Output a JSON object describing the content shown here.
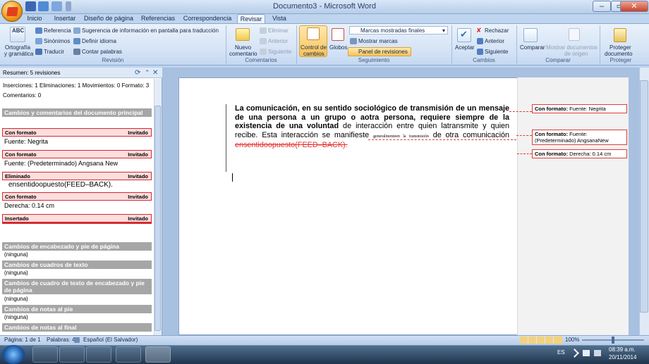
{
  "window": {
    "title": "Documento3 - Microsoft Word",
    "controls": {
      "minimize": "–",
      "maximize": "▭",
      "close": "✕"
    }
  },
  "tabs": [
    "Inicio",
    "Insertar",
    "Diseño de página",
    "Referencias",
    "Correspondencia",
    "Revisar",
    "Vista"
  ],
  "active_tab": "Revisar",
  "ribbon": {
    "revision": {
      "label": "Revisión",
      "ortografia": [
        "Ortografía",
        "y gramática"
      ],
      "referencia": "Referencia",
      "sinonimos": "Sinónimos",
      "traducir": "Traducir",
      "sugerencia": "Sugerencia de información en pantalla para traducción",
      "definir_idioma": "Definir idioma",
      "contar_palabras": "Contar palabras"
    },
    "comentarios": {
      "label": "Comentarios",
      "nuevo": [
        "Nuevo",
        "comentario"
      ],
      "eliminar": "Eliminar",
      "anterior": "Anterior",
      "siguiente": "Siguiente"
    },
    "seguimiento": {
      "label": "Seguimiento",
      "control": [
        "Control de",
        "cambios"
      ],
      "globos": "Globos",
      "marcas_select": "Marcas mostradas finales",
      "mostrar_marcas": "Mostrar marcas",
      "panel": "Panel de revisiones"
    },
    "cambios": {
      "label": "Cambios",
      "aceptar": "Aceptar",
      "rechazar": "Rechazar",
      "anterior": "Anterior",
      "siguiente": "Siguiente"
    },
    "comparar": {
      "label": "Comparar",
      "comparar": "Comparar",
      "mostrar": [
        "Mostrar documentos",
        "de origen"
      ]
    },
    "proteger": {
      "label": "Proteger",
      "proteger": [
        "Proteger",
        "documento"
      ]
    }
  },
  "pane": {
    "summary": "Resumen: 5 revisiones",
    "counts": "Inserciones: 1  Eliminaciones: 1  Movimientos: 0  Formato: 3",
    "comments": "Comentarios: 0",
    "main_section": "Cambios y comentarios del documento principal",
    "revisions": [
      {
        "type": "Con formato",
        "author": "Invitado",
        "detail": "Fuente: Negrita"
      },
      {
        "type": "Con formato",
        "author": "Invitado",
        "detail": "Fuente: (Predeterminado) Angsana New"
      },
      {
        "type": "Eliminado",
        "author": "Invitado",
        "detail": "ensentidoopuesto(FEED–BACK)."
      },
      {
        "type": "Con formato",
        "author": "Invitado",
        "detail": "Derecha:  0.14 cm"
      },
      {
        "type": "Insertado",
        "author": "Invitado",
        "detail": ""
      }
    ],
    "other_sections": [
      {
        "title": "Cambios de encabezado y pie de página",
        "value": "(ninguna)"
      },
      {
        "title": "Cambios de cuadros de texto",
        "value": "(ninguna)"
      },
      {
        "title": "Cambios de cuadro de texto de encabezado y pie de página",
        "value": "(ninguna)"
      },
      {
        "title": "Cambios de notas al pie",
        "value": "(ninguna)"
      },
      {
        "title": "Cambios de notas al final",
        "value": ""
      }
    ]
  },
  "document": {
    "bold_text": "La comunicación, en su sentido sociológico de transmisión de un mensaje de una persona a un grupo o aotra persona, requiere siempre de la existencia de una voluntad",
    "normal_text_1": " de interacción entre quien latransmite y quien recibe. Esta interacción se manifieste ",
    "small_text": "generalmenteen la transmisión",
    "normal_text_2": " de otra comunicación ",
    "deleted_text": "ensentidoopuesto(FEED–BACK)."
  },
  "balloons": [
    {
      "label": "Con formato:",
      "text": " Fuente: Negrita"
    },
    {
      "label": "Con formato:",
      "text": " Fuente: (Predeterminado) AngsanaNew"
    },
    {
      "label": "Con formato:",
      "text": " Derecha:  0.14 cm"
    }
  ],
  "status": {
    "page": "Página: 1 de 1",
    "words": "Palabras: 46",
    "language": "Español (El Salvador)",
    "zoom": "100%"
  },
  "taskbar": {
    "lang": "ES",
    "time": "08:39 a.m.",
    "date": "20/11/2014"
  },
  "colors": {
    "revision_red": "#e23b3b",
    "ribbon_blue": "#d3e2f5",
    "section_gray": "#a6a6a6"
  }
}
